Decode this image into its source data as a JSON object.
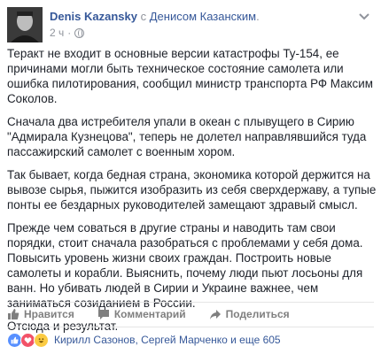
{
  "header": {
    "author": "Denis Kazansky",
    "with_prefix": "с",
    "with_name": "Денисом Казанским",
    "with_suffix": ".",
    "time": "2 ч",
    "dot": "·",
    "privacy_icon": "globe-icon",
    "menu_icon": "chevron-down-icon"
  },
  "post": {
    "paragraphs": [
      "Теракт не входит в основные версии катастрофы Ту-154, ее причинами могли быть техническое состояние самолета или ошибка пилотирования, сообщил министр транспорта РФ Максим Соколов.",
      "Сначала два истребителя упали в океан с плывущего в Сирию \"Адмирала Кузнецова\", теперь не долетел направлявшийся туда пассажирский самолет с военным хором.",
      "Так бывает, когда бедная страна, экономика которой держится на вывозе сырья, пыжится изобразить из себя сверхдержаву, а тупые понты ее бездарных руководителей замещают здравый смысл.",
      "Прежде чем соваться в другие страны и наводить там свои порядки, стоит сначала разобраться с проблемами у себя дома. Повысить уровень жизни своих граждан. Построить новые самолеты и корабли. Выяснить, почему люди пьют лосьоны для ванн. Но убивать людей в Сирии и Украине важнее, чем заниматься созиданием в России.",
      "Отсюда и результат."
    ]
  },
  "actions": {
    "like": "Нравится",
    "comment": "Комментарий",
    "share": "Поделиться"
  },
  "reactions": {
    "icons": [
      "like-icon",
      "love-icon",
      "haha-icon"
    ],
    "summary": "Кирилл Сазонов, Сергей Марченко и еще 605"
  },
  "colors": {
    "link": "#365899",
    "muted": "#90949c",
    "text": "#1d2129",
    "action": "#7f7f7f"
  }
}
